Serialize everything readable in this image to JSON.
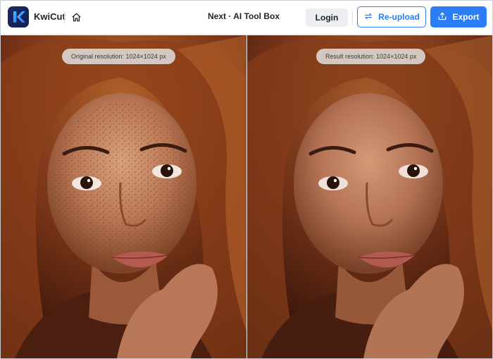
{
  "header": {
    "brand": "KwiCut",
    "title": "Next · AI Tool Box",
    "login_label": "Login",
    "reupload_label": "Re-upload",
    "export_label": "Export"
  },
  "icons": [
    "kwicut-logo-icon",
    "home-icon",
    "sync-arrows-icon",
    "upload-tray-icon"
  ],
  "colors": {
    "accent": "#2a7cf7",
    "logo_bg": "#1b2a6b",
    "login_bg": "#eceef1"
  },
  "compare": {
    "left_label": "Original resolution: 1024×1024 px",
    "right_label": "Result resolution: 1024×1024 px"
  }
}
